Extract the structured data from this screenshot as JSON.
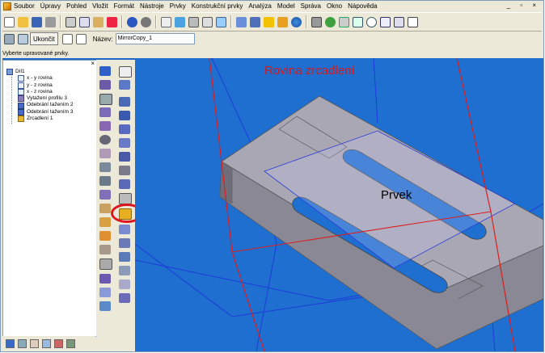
{
  "menu": {
    "items": [
      "Soubor",
      "Úpravy",
      "Pohled",
      "Vložit",
      "Formát",
      "Nástroje",
      "Prvky",
      "Konstrukční prvky",
      "Analýza",
      "Model",
      "Správa",
      "Okno",
      "Nápověda"
    ],
    "window_controls": "_ ▫ ×"
  },
  "feature_bar": {
    "finish_label": "Ukončit",
    "name_label": "Název:",
    "name_value": "MirrorCopy_1"
  },
  "status": {
    "prompt": "Vyberte upravované prvky."
  },
  "tree": {
    "root": "Díl1",
    "items": [
      {
        "label": "x - y rovina",
        "icon": "plane-icon"
      },
      {
        "label": "y - z rovina",
        "icon": "plane-icon"
      },
      {
        "label": "x - z rovina",
        "icon": "plane-icon"
      },
      {
        "label": "Vytažení profilu 3",
        "icon": "extrude-icon"
      },
      {
        "label": "Odebrání tažením 2",
        "icon": "cut-icon"
      },
      {
        "label": "Odebrání tažením 3",
        "icon": "cut-icon"
      },
      {
        "label": "Zrcadlení 1",
        "icon": "mirror-icon"
      }
    ]
  },
  "viewport": {
    "annotation_plane": "Rovina zrcadlení",
    "annotation_feature": "Prvek"
  },
  "colors": {
    "viewport_bg": "#1e6fd0",
    "part_top": "#a9a7b4",
    "part_side": "#8a8894",
    "mirror_plane": "#dc1e1e",
    "highlight": "#e0141c"
  }
}
